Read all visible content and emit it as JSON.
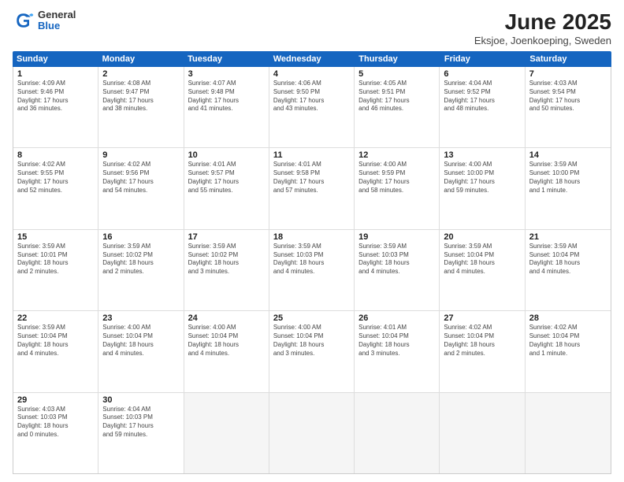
{
  "header": {
    "logo": {
      "general": "General",
      "blue": "Blue"
    },
    "title": "June 2025",
    "location": "Eksjoe, Joenkoeping, Sweden"
  },
  "days_of_week": [
    "Sunday",
    "Monday",
    "Tuesday",
    "Wednesday",
    "Thursday",
    "Friday",
    "Saturday"
  ],
  "weeks": [
    [
      {
        "day": "1",
        "info": "Sunrise: 4:09 AM\nSunset: 9:46 PM\nDaylight: 17 hours\nand 36 minutes."
      },
      {
        "day": "2",
        "info": "Sunrise: 4:08 AM\nSunset: 9:47 PM\nDaylight: 17 hours\nand 38 minutes."
      },
      {
        "day": "3",
        "info": "Sunrise: 4:07 AM\nSunset: 9:48 PM\nDaylight: 17 hours\nand 41 minutes."
      },
      {
        "day": "4",
        "info": "Sunrise: 4:06 AM\nSunset: 9:50 PM\nDaylight: 17 hours\nand 43 minutes."
      },
      {
        "day": "5",
        "info": "Sunrise: 4:05 AM\nSunset: 9:51 PM\nDaylight: 17 hours\nand 46 minutes."
      },
      {
        "day": "6",
        "info": "Sunrise: 4:04 AM\nSunset: 9:52 PM\nDaylight: 17 hours\nand 48 minutes."
      },
      {
        "day": "7",
        "info": "Sunrise: 4:03 AM\nSunset: 9:54 PM\nDaylight: 17 hours\nand 50 minutes."
      }
    ],
    [
      {
        "day": "8",
        "info": "Sunrise: 4:02 AM\nSunset: 9:55 PM\nDaylight: 17 hours\nand 52 minutes."
      },
      {
        "day": "9",
        "info": "Sunrise: 4:02 AM\nSunset: 9:56 PM\nDaylight: 17 hours\nand 54 minutes."
      },
      {
        "day": "10",
        "info": "Sunrise: 4:01 AM\nSunset: 9:57 PM\nDaylight: 17 hours\nand 55 minutes."
      },
      {
        "day": "11",
        "info": "Sunrise: 4:01 AM\nSunset: 9:58 PM\nDaylight: 17 hours\nand 57 minutes."
      },
      {
        "day": "12",
        "info": "Sunrise: 4:00 AM\nSunset: 9:59 PM\nDaylight: 17 hours\nand 58 minutes."
      },
      {
        "day": "13",
        "info": "Sunrise: 4:00 AM\nSunset: 10:00 PM\nDaylight: 17 hours\nand 59 minutes."
      },
      {
        "day": "14",
        "info": "Sunrise: 3:59 AM\nSunset: 10:00 PM\nDaylight: 18 hours\nand 1 minute."
      }
    ],
    [
      {
        "day": "15",
        "info": "Sunrise: 3:59 AM\nSunset: 10:01 PM\nDaylight: 18 hours\nand 2 minutes."
      },
      {
        "day": "16",
        "info": "Sunrise: 3:59 AM\nSunset: 10:02 PM\nDaylight: 18 hours\nand 2 minutes."
      },
      {
        "day": "17",
        "info": "Sunrise: 3:59 AM\nSunset: 10:02 PM\nDaylight: 18 hours\nand 3 minutes."
      },
      {
        "day": "18",
        "info": "Sunrise: 3:59 AM\nSunset: 10:03 PM\nDaylight: 18 hours\nand 4 minutes."
      },
      {
        "day": "19",
        "info": "Sunrise: 3:59 AM\nSunset: 10:03 PM\nDaylight: 18 hours\nand 4 minutes."
      },
      {
        "day": "20",
        "info": "Sunrise: 3:59 AM\nSunset: 10:04 PM\nDaylight: 18 hours\nand 4 minutes."
      },
      {
        "day": "21",
        "info": "Sunrise: 3:59 AM\nSunset: 10:04 PM\nDaylight: 18 hours\nand 4 minutes."
      }
    ],
    [
      {
        "day": "22",
        "info": "Sunrise: 3:59 AM\nSunset: 10:04 PM\nDaylight: 18 hours\nand 4 minutes."
      },
      {
        "day": "23",
        "info": "Sunrise: 4:00 AM\nSunset: 10:04 PM\nDaylight: 18 hours\nand 4 minutes."
      },
      {
        "day": "24",
        "info": "Sunrise: 4:00 AM\nSunset: 10:04 PM\nDaylight: 18 hours\nand 4 minutes."
      },
      {
        "day": "25",
        "info": "Sunrise: 4:00 AM\nSunset: 10:04 PM\nDaylight: 18 hours\nand 3 minutes."
      },
      {
        "day": "26",
        "info": "Sunrise: 4:01 AM\nSunset: 10:04 PM\nDaylight: 18 hours\nand 3 minutes."
      },
      {
        "day": "27",
        "info": "Sunrise: 4:02 AM\nSunset: 10:04 PM\nDaylight: 18 hours\nand 2 minutes."
      },
      {
        "day": "28",
        "info": "Sunrise: 4:02 AM\nSunset: 10:04 PM\nDaylight: 18 hours\nand 1 minute."
      }
    ],
    [
      {
        "day": "29",
        "info": "Sunrise: 4:03 AM\nSunset: 10:03 PM\nDaylight: 18 hours\nand 0 minutes."
      },
      {
        "day": "30",
        "info": "Sunrise: 4:04 AM\nSunset: 10:03 PM\nDaylight: 17 hours\nand 59 minutes."
      },
      {
        "day": "",
        "info": ""
      },
      {
        "day": "",
        "info": ""
      },
      {
        "day": "",
        "info": ""
      },
      {
        "day": "",
        "info": ""
      },
      {
        "day": "",
        "info": ""
      }
    ]
  ]
}
